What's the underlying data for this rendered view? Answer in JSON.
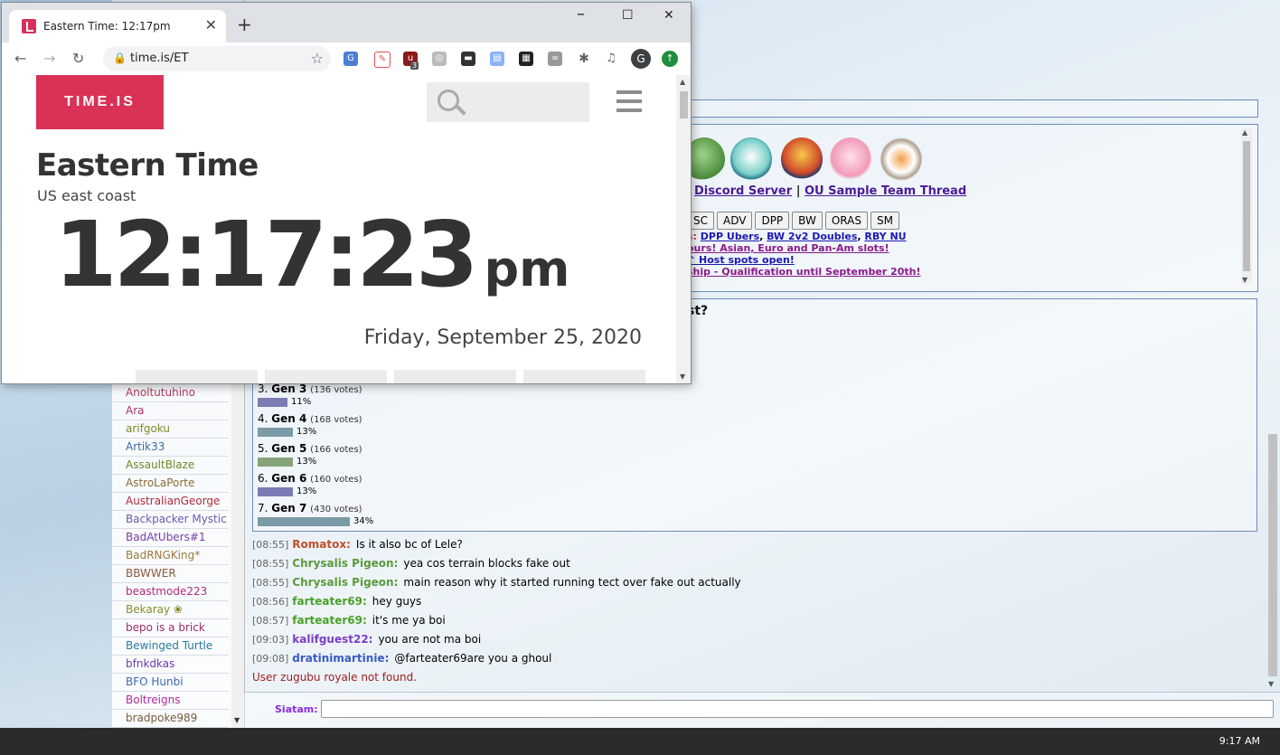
{
  "browser": {
    "tab_title": "Eastern Time: 12:17pm",
    "url": "time.is/ET",
    "profile_initial": "G",
    "ext_badge": "3"
  },
  "timeis": {
    "logo": "TIME.IS",
    "place_title": "Eastern Time",
    "place_subtitle": "US east coast",
    "time": "12:17:23",
    "ampm": "pm",
    "date": "Friday, September 25, 2020"
  },
  "intro": {
    "links": [
      "Discord Server",
      "OU Sample Team Thread"
    ],
    "separator": "|",
    "gen_buttons": [
      "SC",
      "ADV",
      "DPP",
      "BW",
      "ORAS",
      "SM"
    ],
    "news": [
      {
        "prefix": "s:",
        "links": [
          "DPP Ubers",
          "BW 2v2 Doubles",
          "RBY NU"
        ]
      },
      {
        "prefix": "",
        "text": "ours! Asian, Euro and Pan-Am slots!"
      },
      {
        "prefix": "",
        "text": "^ Host spots open!"
      },
      {
        "prefix": "",
        "text": "ship - Qualification until September 20th!"
      }
    ]
  },
  "poll": {
    "question_tail": "st?",
    "options": [
      {
        "num": "3.",
        "label": "Gen 3",
        "votes": "(136 votes)",
        "pct": "11%",
        "percent": 11,
        "color": "#7c7cb4"
      },
      {
        "num": "4.",
        "label": "Gen 4",
        "votes": "(168 votes)",
        "pct": "13%",
        "percent": 13,
        "color": "#7a9aa6"
      },
      {
        "num": "5.",
        "label": "Gen 5",
        "votes": "(166 votes)",
        "pct": "13%",
        "percent": 13,
        "color": "#86a37a"
      },
      {
        "num": "6.",
        "label": "Gen 6",
        "votes": "(160 votes)",
        "pct": "13%",
        "percent": 13,
        "color": "#7c7cb4"
      },
      {
        "num": "7.",
        "label": "Gen 7",
        "votes": "(430 votes)",
        "pct": "34%",
        "percent": 34,
        "color": "#7a9aa6"
      }
    ]
  },
  "chat": [
    {
      "ts": "[08:55]",
      "user": "Romatox:",
      "color": "#c0502a",
      "text": "Is it also bc of Lele?"
    },
    {
      "ts": "[08:55]",
      "user": "Chrysalis Pigeon:",
      "color": "#5a9a3a",
      "text": "yea cos terrain blocks fake out"
    },
    {
      "ts": "[08:55]",
      "user": "Chrysalis Pigeon:",
      "color": "#5a9a3a",
      "text": "main reason why it started running tect over fake out actually"
    },
    {
      "ts": "[08:56]",
      "user": "farteater69:",
      "color": "#4aa02a",
      "text": "hey guys"
    },
    {
      "ts": "[08:57]",
      "user": "farteater69:",
      "color": "#4aa02a",
      "text": "it's me ya boi"
    },
    {
      "ts": "[09:03]",
      "user": "kalifguest22:",
      "color": "#7b3fc4",
      "text": "you are not ma boi"
    },
    {
      "ts": "[09:08]",
      "user": "dratinimartinie:",
      "color": "#3a5ac4",
      "text": "@farteater69are you a ghoul"
    }
  ],
  "chat_error": "User zugubu royale not found.",
  "userlist": [
    {
      "name": "Anoltutuhino",
      "color": "#b03a5a"
    },
    {
      "name": "Ara",
      "color": "#b0306a"
    },
    {
      "name": "arifgoku",
      "color": "#7a8a2a"
    },
    {
      "name": "Artik33",
      "color": "#3a6aa0"
    },
    {
      "name": "AssaultBlaze",
      "color": "#6a8a2a"
    },
    {
      "name": "AstroLaPorte",
      "color": "#8a6a3a"
    },
    {
      "name": "AustralianGeorge",
      "color": "#b02a3a"
    },
    {
      "name": "Backpacker Mystic",
      "color": "#6a5ab0"
    },
    {
      "name": "BadAtUbers#1",
      "color": "#7a3ab0"
    },
    {
      "name": "BadRNGKing*",
      "color": "#9a7a3a"
    },
    {
      "name": "BBWWER",
      "color": "#8a5a3a"
    },
    {
      "name": "beastmode223",
      "color": "#b02a7a"
    },
    {
      "name": "Bekaray ❀",
      "color": "#8a8a2a"
    },
    {
      "name": "bepo is a brick",
      "color": "#a02a6a"
    },
    {
      "name": "Bewinged Turtle",
      "color": "#2a7aa0"
    },
    {
      "name": "bfnkdkas",
      "color": "#6a3ab0"
    },
    {
      "name": "BFO Hunbi",
      "color": "#3a6ab0"
    },
    {
      "name": "Boltreigns",
      "color": "#b02aa0"
    },
    {
      "name": "bradpoke989",
      "color": "#7a5a3a"
    }
  ],
  "compose": {
    "username": "Siatam:"
  },
  "taskbar": {
    "clock": "9:17 AM"
  }
}
